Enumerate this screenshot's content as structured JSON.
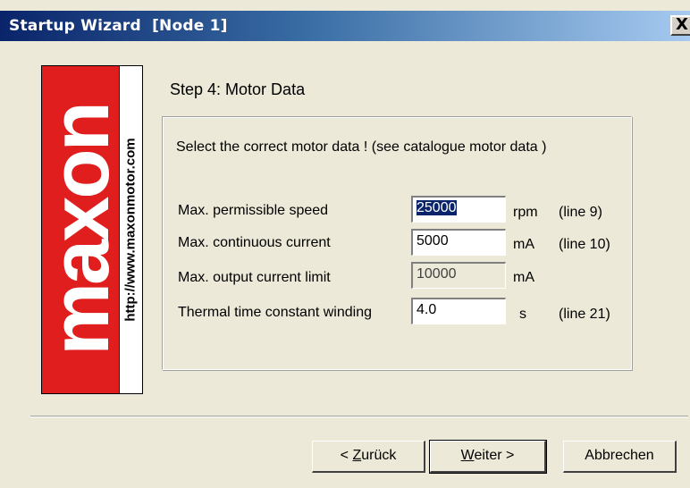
{
  "window": {
    "title": "Startup Wizard  [Node 1]",
    "close_glyph": "X"
  },
  "logo": {
    "brand": "maxon",
    "url": "http://www.maxonmotor.com",
    "brand_color": "#e01e1e"
  },
  "step": {
    "title": "Step 4: Motor Data"
  },
  "group": {
    "instruction": "Select the correct motor data ! (see catalogue motor data )",
    "rows": [
      {
        "label": "Max. permissible speed",
        "value": "25000",
        "unit": "rpm",
        "ref": "(line 9)",
        "selected": true,
        "enabled": true
      },
      {
        "label": "Max. continuous current",
        "value": "5000",
        "unit": "mA",
        "ref": "(line 10)",
        "selected": false,
        "enabled": true
      },
      {
        "label": "Max. output current limit",
        "value": "10000",
        "unit": "mA",
        "ref": "",
        "selected": false,
        "enabled": false
      },
      {
        "label": "Thermal time constant winding",
        "value": "4.0",
        "unit": "s",
        "ref": "(line 21)",
        "selected": false,
        "enabled": true
      }
    ]
  },
  "buttons": {
    "back_prefix": "< ",
    "back_mnemonic": "Z",
    "back_rest": "urück",
    "next_mnemonic": "W",
    "next_rest": "eiter >",
    "cancel": "Abbrechen"
  }
}
